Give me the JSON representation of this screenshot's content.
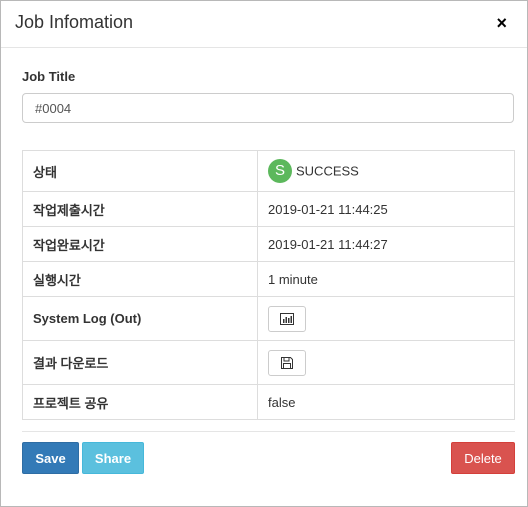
{
  "modal": {
    "title": "Job Infomation",
    "close_label": "×"
  },
  "job_title": {
    "label": "Job Title",
    "value": "#0004"
  },
  "info_rows": {
    "status": {
      "label": "상태",
      "icon_letter": "S",
      "value": "SUCCESS",
      "icon": "success-badge",
      "color": "#5cb85c"
    },
    "submit_time": {
      "label": "작업제출시간",
      "value": "2019-01-21 11:44:25"
    },
    "complete_time": {
      "label": "작업완료시간",
      "value": "2019-01-21 11:44:27"
    },
    "run_time": {
      "label": "실행시간",
      "value": "1 minute"
    },
    "system_log": {
      "label": "System Log (Out)",
      "icon": "bar-chart-icon"
    },
    "download": {
      "label": "결과 다운로드",
      "icon": "floppy-disk-icon"
    },
    "project_share": {
      "label": "프로젝트 공유",
      "value": "false"
    }
  },
  "footer": {
    "save_label": "Save",
    "share_label": "Share",
    "delete_label": "Delete"
  },
  "colors": {
    "save": "#337ab7",
    "share": "#5bc0de",
    "delete": "#d9534f",
    "success": "#5cb85c"
  }
}
